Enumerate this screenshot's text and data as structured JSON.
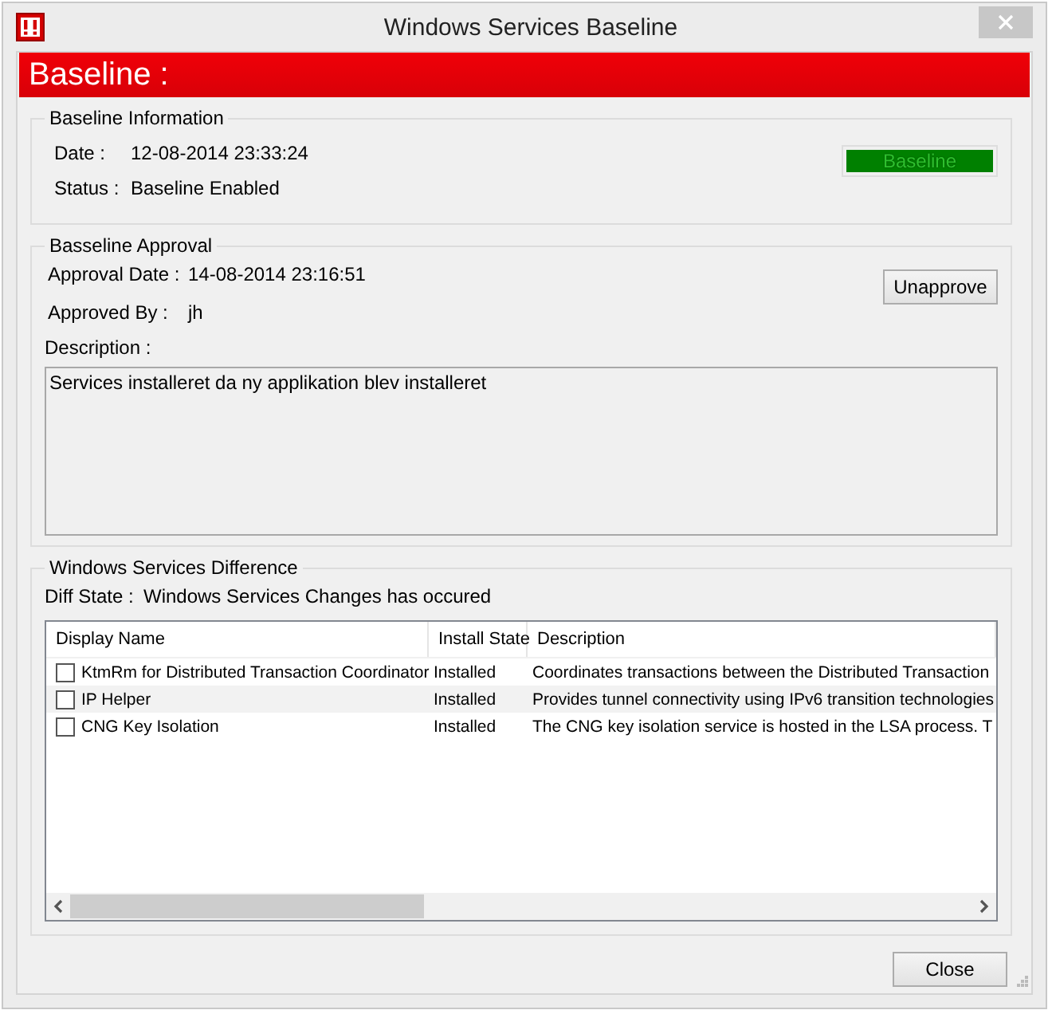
{
  "window": {
    "title": "Windows Services Baseline"
  },
  "header": "Baseline :",
  "baseline_information": {
    "title": "Baseline Information",
    "date_label": "Date :",
    "date": "12-08-2014 23:33:24",
    "status_label": "Status :",
    "status": "Baseline Enabled",
    "indicator": "Baseline"
  },
  "approval": {
    "title": "Basseline Approval",
    "date_label": "Approval Date :",
    "date": "14-08-2014 23:16:51",
    "by_label": "Approved By :",
    "by": "jh",
    "button": "Unapprove",
    "description_label": "Description :",
    "description": "Services installeret da ny applikation blev installeret"
  },
  "difference": {
    "title": "Windows Services Difference",
    "state_label": "Diff State :",
    "state": "Windows Services Changes has occured",
    "table": {
      "columns": [
        "Display Name",
        "Install State",
        "Description"
      ],
      "rows": [
        {
          "checked": false,
          "cells": [
            "KtmRm for Distributed Transaction Coordinator",
            "Installed",
            "Coordinates transactions between the Distributed Transaction"
          ]
        },
        {
          "checked": false,
          "cells": [
            "IP Helper",
            "Installed",
            "Provides tunnel connectivity using IPv6 transition technologies"
          ]
        },
        {
          "checked": false,
          "cells": [
            "CNG Key Isolation",
            "Installed",
            "The CNG key isolation service is hosted in the LSA process. T"
          ]
        }
      ]
    }
  },
  "buttons": [
    "Close"
  ]
}
